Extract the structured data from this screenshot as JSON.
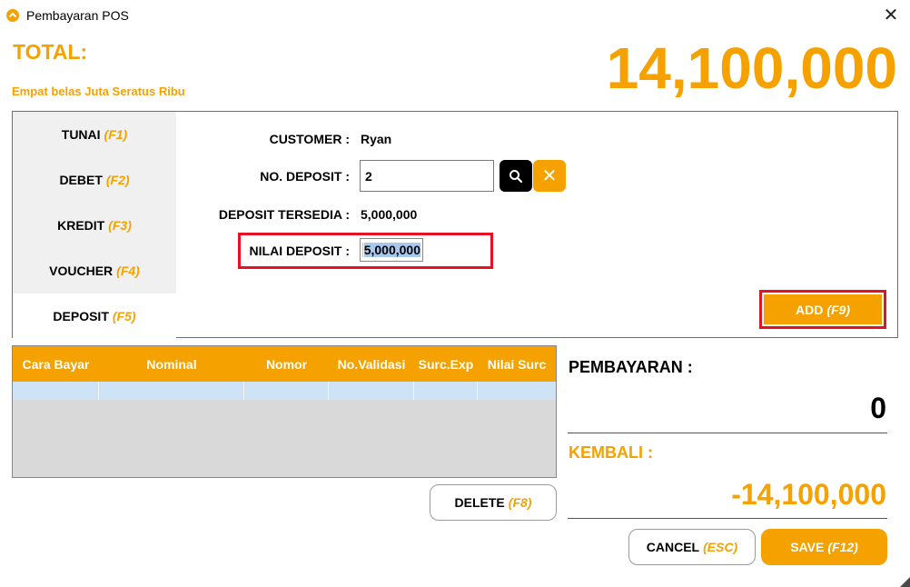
{
  "window": {
    "title": "Pembayaran POS",
    "close_glyph": "✕",
    "icon": "app-logo-icon"
  },
  "header": {
    "total_label": "TOTAL:",
    "total_words": "Empat belas Juta Seratus Ribu",
    "total_amount": "14,100,000"
  },
  "tabs": [
    {
      "label": "TUNAI",
      "key": "(F1)",
      "active": false
    },
    {
      "label": "DEBET",
      "key": "(F2)",
      "active": false
    },
    {
      "label": "KREDIT",
      "key": "(F3)",
      "active": false
    },
    {
      "label": "VOUCHER",
      "key": "(F4)",
      "active": false
    },
    {
      "label": "DEPOSIT",
      "key": "(F5)",
      "active": true
    }
  ],
  "deposit_form": {
    "customer_label": "CUSTOMER :",
    "customer_value": "Ryan",
    "no_deposit_label": "NO. DEPOSIT :",
    "no_deposit_value": "2",
    "deposit_tersedia_label": "DEPOSIT TERSEDIA :",
    "deposit_tersedia_value": "5,000,000",
    "nilai_deposit_label": "NILAI DEPOSIT :",
    "nilai_deposit_value": "5,000,000",
    "search_icon": "search-icon",
    "clear_glyph": "✕",
    "add_label": "ADD",
    "add_key": "(F9)"
  },
  "grid": {
    "columns": [
      "Cara Bayar",
      "Nominal",
      "Nomor",
      "No.Validasi",
      "Surc.Exp",
      "Nilai Surc"
    ],
    "rows": [
      [
        "",
        "",
        "",
        "",
        "",
        ""
      ]
    ]
  },
  "actions": {
    "delete_label": "DELETE",
    "delete_key": "(F8)",
    "cancel_label": "CANCEL",
    "cancel_key": "(ESC)",
    "save_label": "SAVE",
    "save_key": "(F12)"
  },
  "summary": {
    "pembayaran_label": "PEMBAYARAN :",
    "pembayaran_value": "0",
    "kembali_label": "KEMBALI :",
    "kembali_value": "-14,100,000"
  },
  "colors": {
    "accent": "#f5a100",
    "highlight": "#e81123",
    "row_selected": "#cfe3f7"
  }
}
